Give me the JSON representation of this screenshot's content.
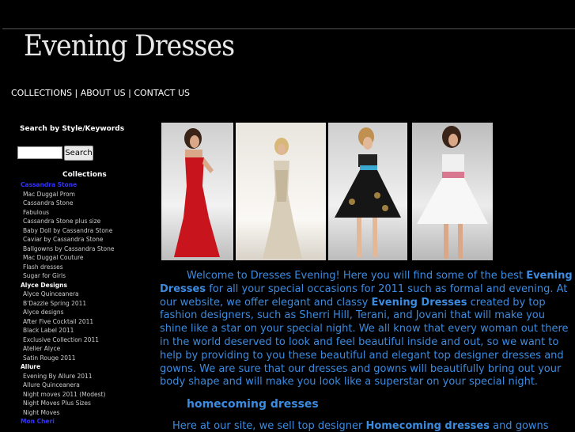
{
  "header": {
    "logo_text": "Evening Dresses"
  },
  "nav": {
    "collections": "COLLECTIONS",
    "sep1": " | ",
    "about": "ABOUT US",
    "sep2": " | ",
    "contact": "CONTACT US"
  },
  "sidebar": {
    "search_heading": "Search by Style/Keywords",
    "search_value": "",
    "search_button": "Search",
    "collections_heading": "Collections",
    "groups": [
      {
        "title": "Cassandra Stone",
        "items": [
          "Mac Duggal Prom",
          "Cassandra Stone",
          "Fabulous",
          "Cassandra Stone plus size",
          "Baby Doll by Cassandra Stone",
          "Caviar by Cassandra Stone",
          "Ballgowns by Cassandra Stone",
          "Mac Duggal Couture",
          "Flash dresses",
          "Sugar for Girls"
        ]
      },
      {
        "title": "Alyce Designs",
        "items": [
          "Alyce Quinceanera",
          "B'Dazzle Spring 2011",
          "Alyce designs",
          "After Five Cocktail 2011",
          "Black Label 2011",
          "Exclusive Collection 2011",
          "Atelier Alyce",
          "Satin Rouge 2011"
        ]
      },
      {
        "title": "Allure",
        "items": [
          "Evening By Allure 2011",
          "Allure Quinceanera",
          "Night moves 2011 (Modest)",
          "Night Moves Plus Sizes",
          "Night Moves"
        ]
      },
      {
        "title": "Mon Cheri",
        "items": []
      }
    ]
  },
  "main": {
    "intro_1": "Welcome to Dresses Evening! Here you will find some of the best ",
    "intro_bold_1": "Evening Dresses",
    "intro_2": "  for all your special occasions for 2011 such as formal and evening. At our website, we offer elegant and classy ",
    "intro_bold_2": "Evening Dresses",
    "intro_3": " created by top fashion designers, such as Sherri Hill, Terani, and Jovani that will make you shine like a star on your special night. We all know that every woman out there in the world deserved to look and feel beautiful inside and out, so we want to help by providing to you these beautiful and elegant top designer dresses and gowns. We are sure that our dresses and gowns will beautifully bring out your body shape and will make you look like a superstar on your special night.",
    "subheading": "homecoming dresses",
    "para2_start": "Here at our site, we sell top designer ",
    "para2_bold": "Homecoming dresses",
    "para2_end": " and gowns"
  },
  "colors": {
    "link_blue": "#3b8be0",
    "group_blue": "#3333ff",
    "background": "#000000"
  }
}
